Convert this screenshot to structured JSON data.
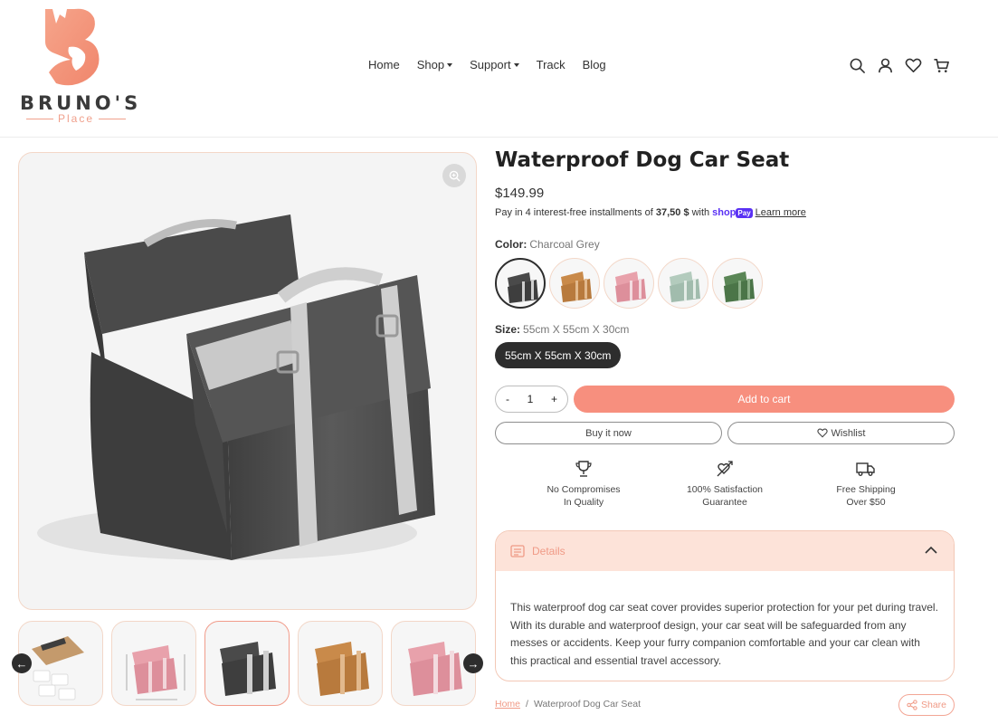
{
  "brand": {
    "name": "BRUNO'S",
    "sub": "Place",
    "accent_color": "#f19c8b"
  },
  "nav": {
    "items": [
      {
        "label": "Home",
        "has_caret": false
      },
      {
        "label": "Shop",
        "has_caret": true
      },
      {
        "label": "Support",
        "has_caret": true
      },
      {
        "label": "Track",
        "has_caret": false
      },
      {
        "label": "Blog",
        "has_caret": false
      }
    ]
  },
  "header_icons": [
    "search-icon",
    "account-icon",
    "wishlist-heart-icon",
    "cart-icon"
  ],
  "product": {
    "title": "Waterproof Dog Car Seat",
    "price": "$149.99",
    "installments": {
      "prefix": "Pay in 4 interest-free installments of",
      "amount": "37,50 $",
      "with": "with",
      "shop": "shop",
      "pay": "Pay",
      "learn_more": "Learn more"
    },
    "color": {
      "label": "Color:",
      "value": "Charcoal Grey",
      "swatches": [
        {
          "name": "Charcoal Grey",
          "hex": "#4a4a4a",
          "active": true
        },
        {
          "name": "Tan",
          "hex": "#c98a4a",
          "active": false
        },
        {
          "name": "Pink",
          "hex": "#e59aa4",
          "active": false
        },
        {
          "name": "Sage",
          "hex": "#a9c2b3",
          "active": false
        },
        {
          "name": "Green",
          "hex": "#4f7a4c",
          "active": false
        }
      ]
    },
    "size": {
      "label": "Size:",
      "value": "55cm X 55cm X 30cm",
      "option": "55cm X 55cm X 30cm"
    },
    "quantity": {
      "minus": "-",
      "value": "1",
      "plus": "+"
    },
    "add_to_cart": "Add to cart",
    "buy_now": "Buy it now",
    "wishlist": "Wishlist",
    "features": [
      {
        "icon": "trophy-icon",
        "line1": "No Compromises",
        "line2": "In Quality"
      },
      {
        "icon": "heart-arrow-icon",
        "line1": "100% Satisfaction",
        "line2": "Guarantee"
      },
      {
        "icon": "truck-icon",
        "line1": "Free Shipping",
        "line2": "Over $50"
      }
    ],
    "details": {
      "heading": "Details",
      "body": "This waterproof dog car seat cover provides superior protection for your pet during travel. With its durable and waterproof design, your car seat will be safeguarded from any messes or accidents. Keep your furry companion comfortable and your car clean with this practical and essential travel accessory."
    }
  },
  "breadcrumb": {
    "home": "Home",
    "separator": "/",
    "current": "Waterproof Dog Car Seat"
  },
  "share": "Share",
  "gallery": {
    "thumbnails": [
      "packaging",
      "pink-dimensions",
      "charcoal",
      "tan",
      "pink"
    ],
    "active_index": 2
  },
  "colors": {
    "charcoal": "#4a4a4a",
    "coral": "#f78f7e",
    "peach_bg": "#fde3d9"
  }
}
